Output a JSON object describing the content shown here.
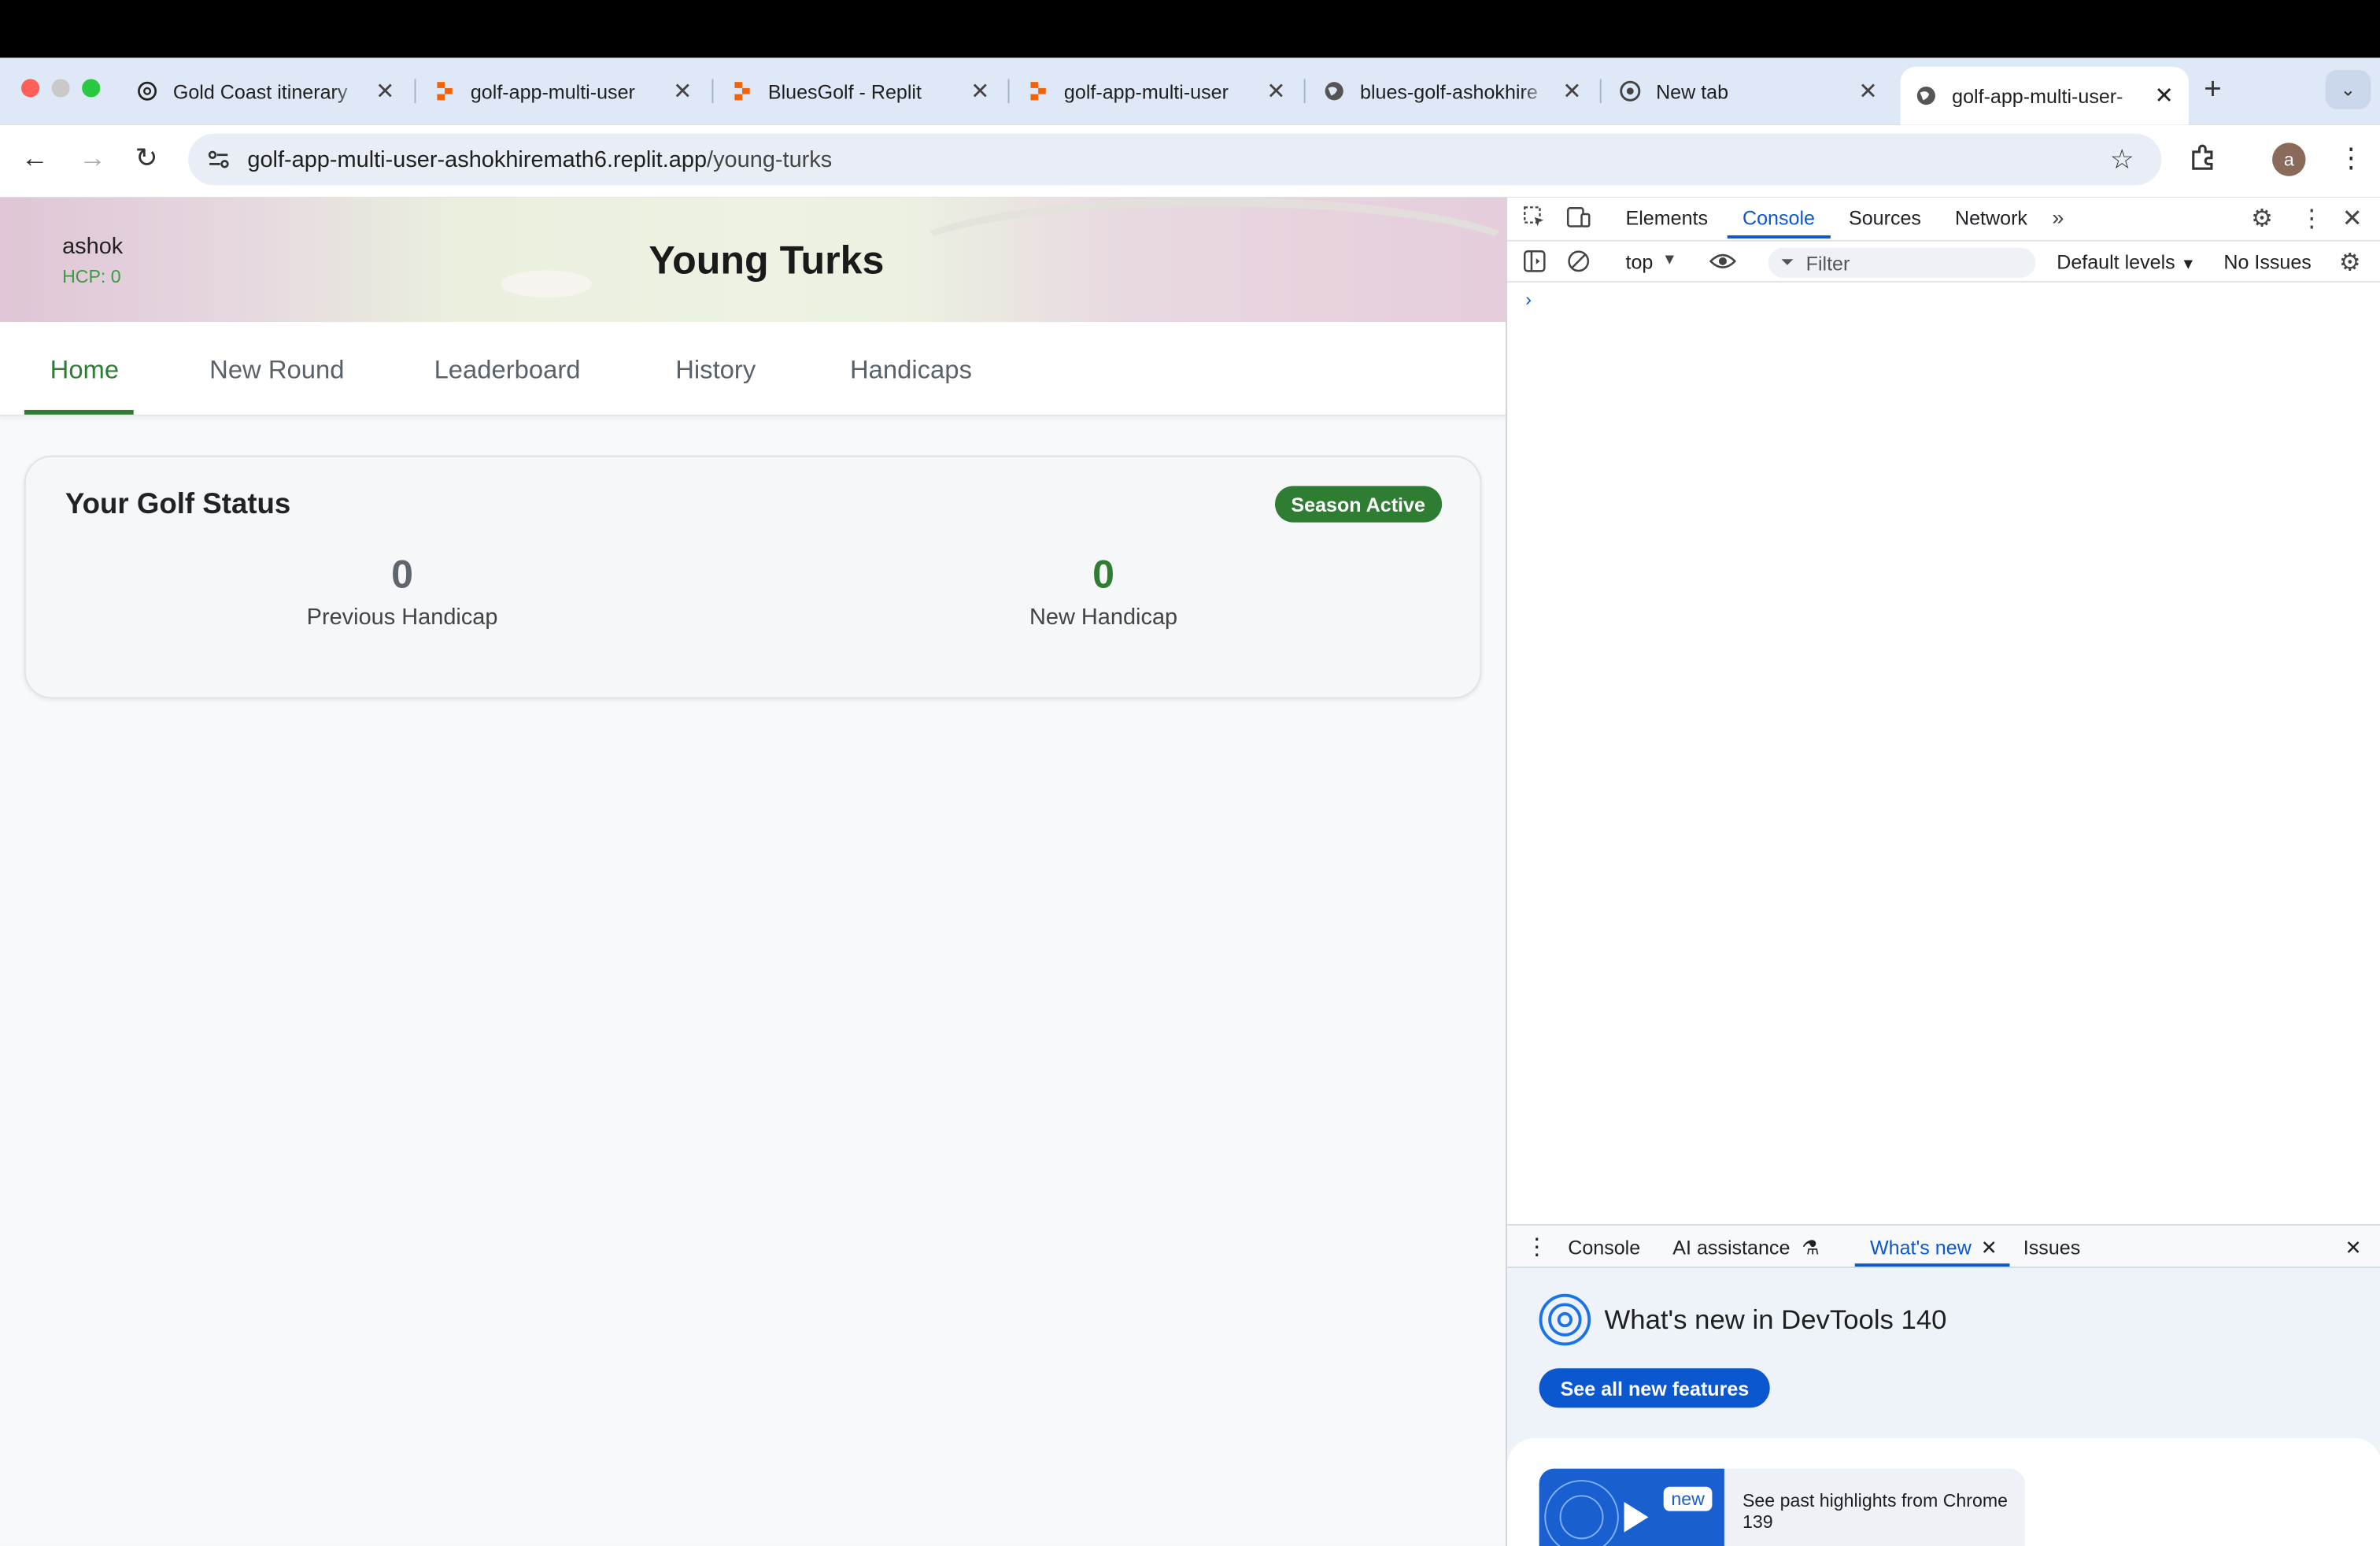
{
  "browser": {
    "tabs": [
      {
        "title": "Gold Coast itinerary",
        "icon": "openai-icon"
      },
      {
        "title": "golf-app-multi-user",
        "icon": "replit-icon"
      },
      {
        "title": "BluesGolf - Replit",
        "icon": "replit-icon"
      },
      {
        "title": "golf-app-multi-user",
        "icon": "replit-icon"
      },
      {
        "title": "blues-golf-ashokhire",
        "icon": "globe-icon"
      },
      {
        "title": "New tab",
        "icon": "chrome-icon"
      },
      {
        "title": "golf-app-multi-user-",
        "icon": "globe-icon"
      }
    ],
    "url_host": "golf-app-multi-user-ashokhiremath6.replit.app",
    "url_path": "/young-turks",
    "avatar_letter": "a"
  },
  "app": {
    "user_name": "ashok",
    "user_hcp": "HCP: 0",
    "title": "Young Turks",
    "nav": [
      "Home",
      "New Round",
      "Leaderboard",
      "History",
      "Handicaps"
    ],
    "active_nav": "Home",
    "status_card": {
      "heading": "Your Golf Status",
      "badge": "Season Active",
      "previous_value": "0",
      "previous_label": "Previous Handicap",
      "new_value": "0",
      "new_label": "New Handicap"
    }
  },
  "devtools": {
    "tabs": [
      "Elements",
      "Console",
      "Sources",
      "Network"
    ],
    "active_tab": "Console",
    "context": "top",
    "filter_placeholder": "Filter",
    "levels": "Default levels",
    "issues": "No Issues",
    "drawer_tabs": [
      "Console",
      "AI assistance",
      "What's new",
      "Issues"
    ],
    "active_drawer_tab": "What's new",
    "whats_new_title": "What's new in DevTools 140",
    "whats_new_button": "See all new features",
    "highlight_badge": "new",
    "highlight_text": "See past highlights from Chrome 139"
  },
  "colors": {
    "accent_green": "#2e7d32",
    "devtools_blue": "#0b57d0"
  }
}
